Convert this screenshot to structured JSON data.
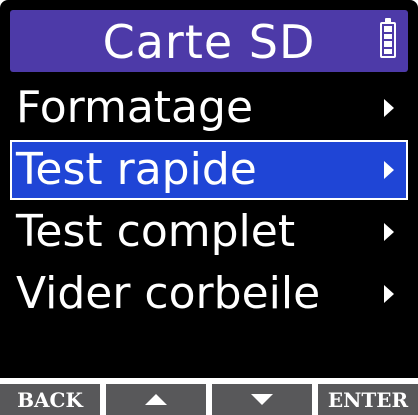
{
  "header": {
    "title": "Carte SD",
    "battery_icon": "battery-full-icon"
  },
  "menu": {
    "items": [
      {
        "label": "Formatage",
        "selected": false,
        "icon": "chevron-right-icon"
      },
      {
        "label": "Test rapide",
        "selected": true,
        "icon": "chevron-right-icon"
      },
      {
        "label": "Test complet",
        "selected": false,
        "icon": "chevron-right-icon"
      },
      {
        "label": "Vider corbeile",
        "selected": false,
        "icon": "chevron-right-icon"
      }
    ]
  },
  "softkeys": {
    "back_label": "BACK",
    "up_icon": "triangle-up-icon",
    "down_icon": "triangle-down-icon",
    "enter_label": "ENTER"
  },
  "colors": {
    "title_bar": "#4d3aa8",
    "selection": "#1f45d6",
    "screen_bg": "#000000",
    "softkey_bg": "#58585a",
    "text": "#ffffff"
  }
}
